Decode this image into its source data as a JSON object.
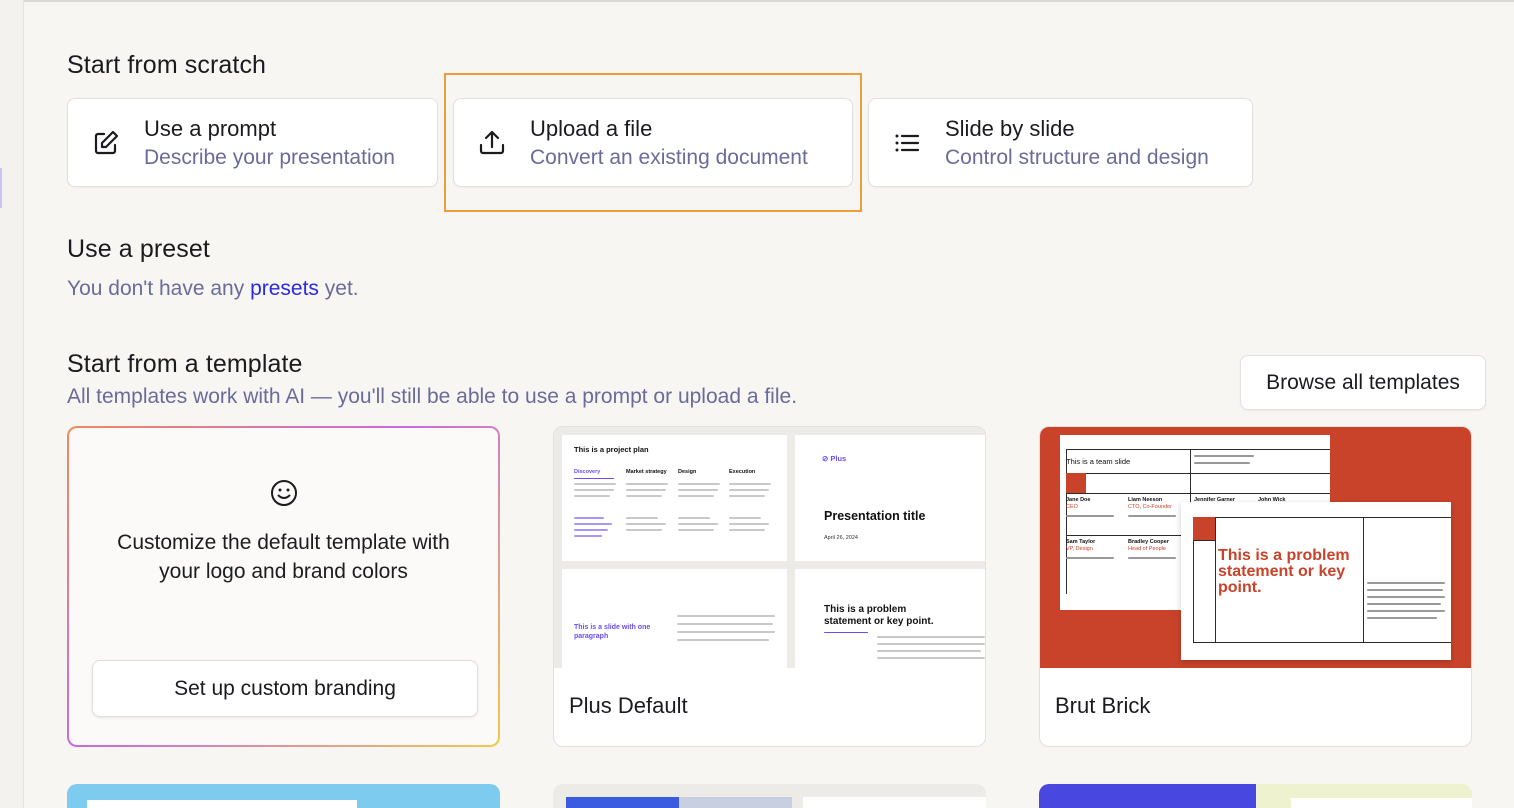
{
  "scratch": {
    "title": "Start from scratch",
    "options": [
      {
        "title": "Use a prompt",
        "subtitle": "Describe your presentation",
        "icon": "edit-icon"
      },
      {
        "title": "Upload a file",
        "subtitle": "Convert an existing document",
        "icon": "upload-icon"
      },
      {
        "title": "Slide by slide",
        "subtitle": "Control structure and design",
        "icon": "list-icon"
      }
    ]
  },
  "preset": {
    "title": "Use a preset",
    "text_before": "You don't have any ",
    "link": "presets",
    "text_after": " yet."
  },
  "templates": {
    "title": "Start from a template",
    "subtitle": "All templates work with AI — you'll still be able to use a prompt or upload a file.",
    "browse_label": "Browse all templates",
    "branding": {
      "text_line1": "Customize the default template with",
      "text_line2": "your logo and brand colors",
      "button_label": "Set up custom branding"
    },
    "cards": [
      {
        "name": "Plus Default",
        "preview": {
          "slide1_title": "This is a project plan",
          "cols": [
            "Discovery",
            "Market strategy",
            "Design",
            "Execution"
          ],
          "logo": "Plus",
          "slide2_title": "Presentation title",
          "slide2_date": "April 26, 2024",
          "slide3_title": "This is a slide with one paragraph",
          "slide4_title": "This is a problem statement or key point."
        }
      },
      {
        "name": "Brut Brick",
        "preview": {
          "slide1_title": "This is a team slide",
          "people": [
            {
              "name": "Jane Doe",
              "role": "CEO"
            },
            {
              "name": "Liam Neeson",
              "role": "CTO, Co-Founder"
            },
            {
              "name": "Jennifer Garner",
              "role": ""
            },
            {
              "name": "John Wick",
              "role": ""
            },
            {
              "name": "Sam Taylor",
              "role": "VP, Design"
            },
            {
              "name": "Bradley Cooper",
              "role": "Head of People"
            }
          ],
          "slide2_title": "This is a problem statement or key point."
        }
      }
    ]
  },
  "colors": {
    "highlight": "#ef9c3a",
    "link": "#2a2ae0",
    "muted": "#6b6b9a",
    "brick": "#c9432a",
    "accent_purple": "#6b4cf6"
  }
}
